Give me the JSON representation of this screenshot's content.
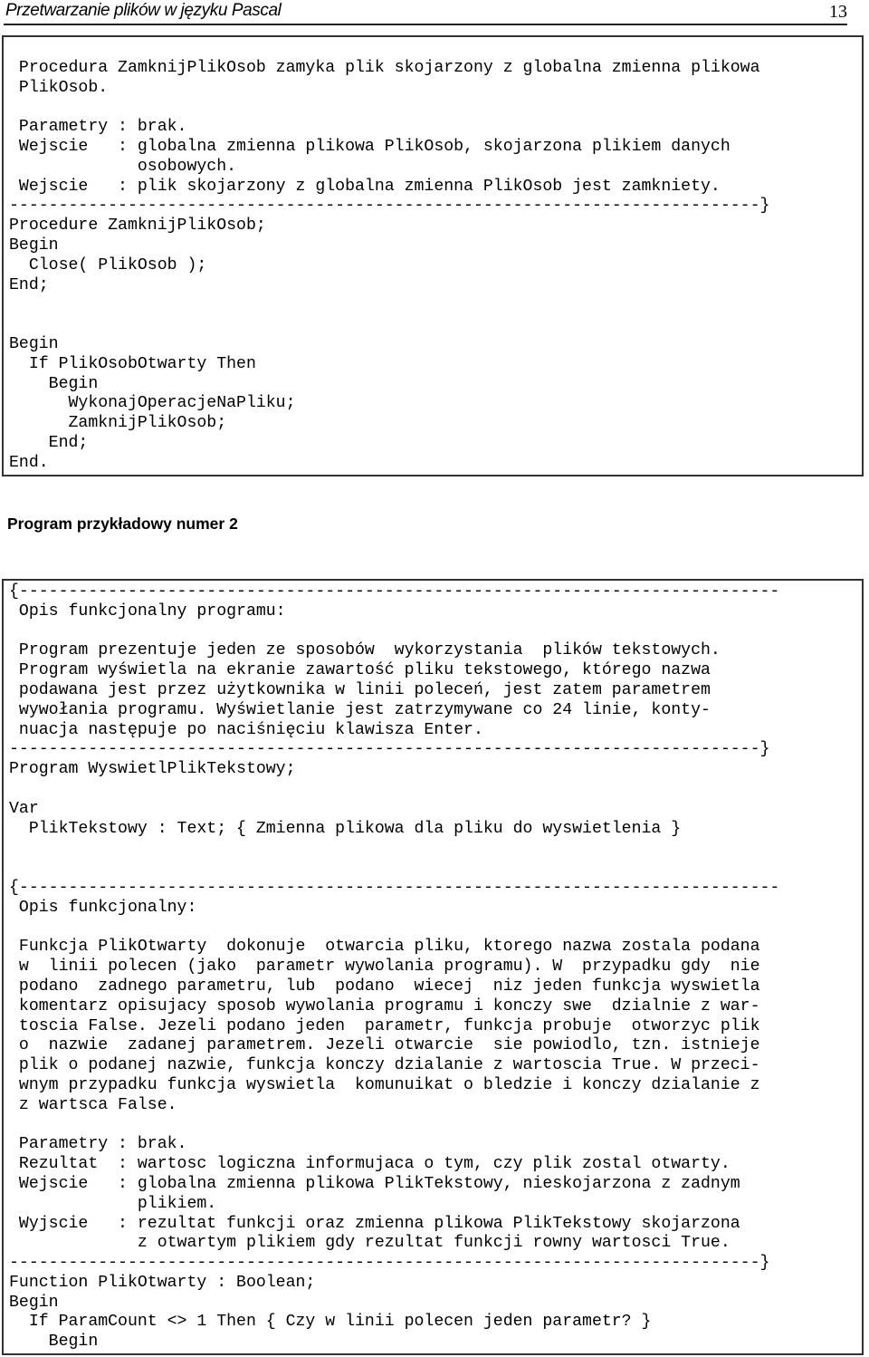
{
  "header": {
    "title": "Przetwarzanie plików w języku Pascal",
    "page_number": "13"
  },
  "box1": {
    "lines": [
      "",
      " Procedura ZamknijPlikOsob zamyka plik skojarzony z globalna zmienna plikowa",
      " PlikOsob.",
      "",
      " Parametry : brak.",
      " Wejscie   : globalna zmienna plikowa PlikOsob, skojarzona plikiem danych",
      "             osobowych.",
      " Wejscie   : plik skojarzony z globalna zmienna PlikOsob jest zamkniety.",
      "----------------------------------------------------------------------------}",
      "Procedure ZamknijPlikOsob;",
      "Begin",
      "  Close( PlikOsob );",
      "End;",
      "",
      "",
      "Begin",
      "  If PlikOsobOtwarty Then",
      "    Begin",
      "      WykonajOperacjeNaPliku;",
      "      ZamknijPlikOsob;",
      "    End;",
      "End."
    ]
  },
  "section_heading": "Program przykładowy numer 2",
  "box2": {
    "lines": [
      "{-----------------------------------------------------------------------------",
      " Opis funkcjonalny programu:",
      "",
      " Program prezentuje jeden ze sposobów  wykorzystania  plików tekstowych.",
      " Program wyświetla na ekranie zawartość pliku tekstowego, którego nazwa",
      " podawana jest przez użytkownika w linii poleceń, jest zatem parametrem",
      " wywołania programu. Wyświetlanie jest zatrzymywane co 24 linie, konty-",
      " nuacja następuje po naciśnięciu klawisza Enter.",
      "----------------------------------------------------------------------------}",
      "Program WyswietlPlikTekstowy;",
      "",
      "Var",
      "  PlikTekstowy : Text; { Zmienna plikowa dla pliku do wyswietlenia }",
      "",
      "",
      "{-----------------------------------------------------------------------------",
      " Opis funkcjonalny:",
      "",
      " Funkcja PlikOtwarty  dokonuje  otwarcia pliku, ktorego nazwa zostala podana",
      " w  linii polecen (jako  parametr wywolania programu). W  przypadku gdy  nie",
      " podano  zadnego parametru, lub  podano  wiecej  niz jeden funkcja wyswietla",
      " komentarz opisujacy sposob wywolania programu i konczy swe  dzialnie z war-",
      " toscia False. Jezeli podano jeden  parametr, funkcja probuje  otworzyc plik",
      " o  nazwie  zadanej parametrem. Jezeli otwarcie  sie powiodlo, tzn. istnieje",
      " plik o podanej nazwie, funkcja konczy dzialanie z wartoscia True. W przeci-",
      " wnym przypadku funkcja wyswietla  komunuikat o bledzie i konczy dzialanie z",
      " z wartsca False.",
      "",
      " Parametry : brak.",
      " Rezultat  : wartosc logiczna informujaca o tym, czy plik zostal otwarty.",
      " Wejscie   : globalna zmienna plikowa PlikTekstowy, nieskojarzona z zadnym",
      "             plikiem.",
      " Wyjscie   : rezultat funkcji oraz zmienna plikowa PlikTekstowy skojarzona",
      "             z otwartym plikiem gdy rezultat funkcji rowny wartosci True.",
      "----------------------------------------------------------------------------}",
      "Function PlikOtwarty : Boolean;",
      "Begin",
      "  If ParamCount <> 1 Then { Czy w linii polecen jeden parametr? }",
      "    Begin"
    ]
  }
}
